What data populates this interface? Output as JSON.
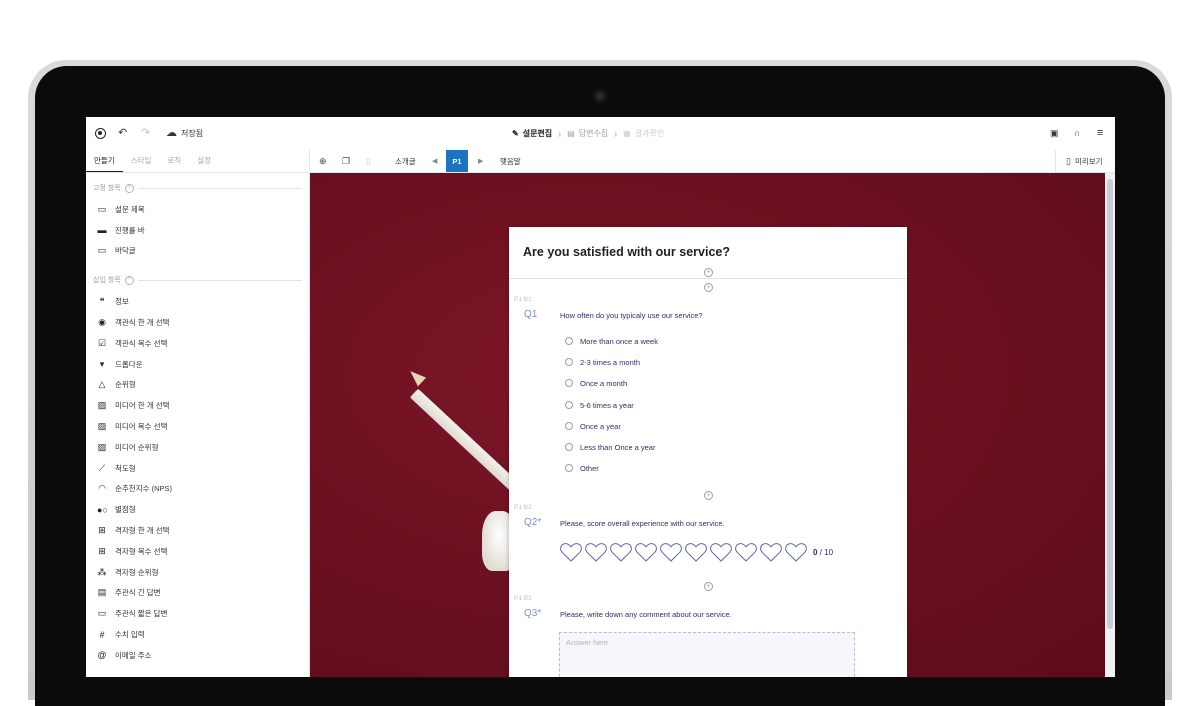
{
  "topbar": {
    "save_status": "저장됨",
    "steps": [
      {
        "label": "설문편집",
        "icon": "pencil-icon",
        "state": "active"
      },
      {
        "label": "답변수집",
        "icon": "clipboard-icon",
        "state": "inactive"
      },
      {
        "label": "결과확인",
        "icon": "chart-icon",
        "state": "disabled"
      }
    ]
  },
  "sidebar": {
    "tabs": [
      "만들기",
      "스타일",
      "로직",
      "설정"
    ],
    "fixed_section_title": "고정 항목",
    "fixed_items": [
      {
        "label": "설문 제목",
        "icon": "title-icon"
      },
      {
        "label": "진행률 바",
        "icon": "progress-bar-icon"
      },
      {
        "label": "바닥글",
        "icon": "footer-icon"
      }
    ],
    "insert_section_title": "삽입 항목",
    "insert_items": [
      {
        "label": "정보",
        "icon": "quote-icon"
      },
      {
        "label": "객관식 한 개 선택",
        "icon": "radio-icon"
      },
      {
        "label": "객관식 복수 선택",
        "icon": "checkbox-icon"
      },
      {
        "label": "드롭다운",
        "icon": "dropdown-icon"
      },
      {
        "label": "순위형",
        "icon": "triangle-icon"
      },
      {
        "label": "미디어 한 개 선택",
        "icon": "media-radio-icon"
      },
      {
        "label": "미디어 복수 선택",
        "icon": "media-check-icon"
      },
      {
        "label": "미디어 순위형",
        "icon": "media-rank-icon"
      },
      {
        "label": "척도형",
        "icon": "ruler-icon"
      },
      {
        "label": "순추천지수 (NPS)",
        "icon": "gauge-icon"
      },
      {
        "label": "별점형",
        "icon": "slider-icon"
      },
      {
        "label": "격자형 한 개 선택",
        "icon": "grid-radio-icon"
      },
      {
        "label": "격자형 복수 선택",
        "icon": "grid-check-icon"
      },
      {
        "label": "격자형 순위형",
        "icon": "grid-rank-icon"
      },
      {
        "label": "주관식 긴 답변",
        "icon": "long-text-icon"
      },
      {
        "label": "주관식 짧은 답변",
        "icon": "short-text-icon"
      },
      {
        "label": "수치 입력",
        "icon": "hash-icon"
      },
      {
        "label": "이메일 주소",
        "icon": "at-icon"
      }
    ]
  },
  "canvas_toolbar": {
    "intro_label": "소개글",
    "page_label": "P1",
    "closing_label": "맺음말",
    "preview_label": "미리보기"
  },
  "survey": {
    "title": "Are you satisfied with our service?",
    "q1": {
      "block": "P1 B1",
      "number": "Q1",
      "text": "How often do you typicaly use our service?",
      "options": [
        "More than once a week",
        "2-3 times a month",
        "Once a month",
        "5-6 times a year",
        "Once a year",
        "Less than Once a year",
        "Other"
      ]
    },
    "q2": {
      "block": "P1 B2",
      "number": "Q2*",
      "text": "Please, score overall experience with our service.",
      "score_value": "0",
      "score_max": "/ 10",
      "hearts_count": 10
    },
    "q3": {
      "block": "P1 B3",
      "number": "Q3*",
      "text": "Please, write down any comment about our service.",
      "placeholder": "Answer here"
    }
  },
  "colors": {
    "accent": "#1e73be",
    "question_text": "#2b2f6b",
    "question_number": "#7e8ec9",
    "background": "#6d1121"
  }
}
